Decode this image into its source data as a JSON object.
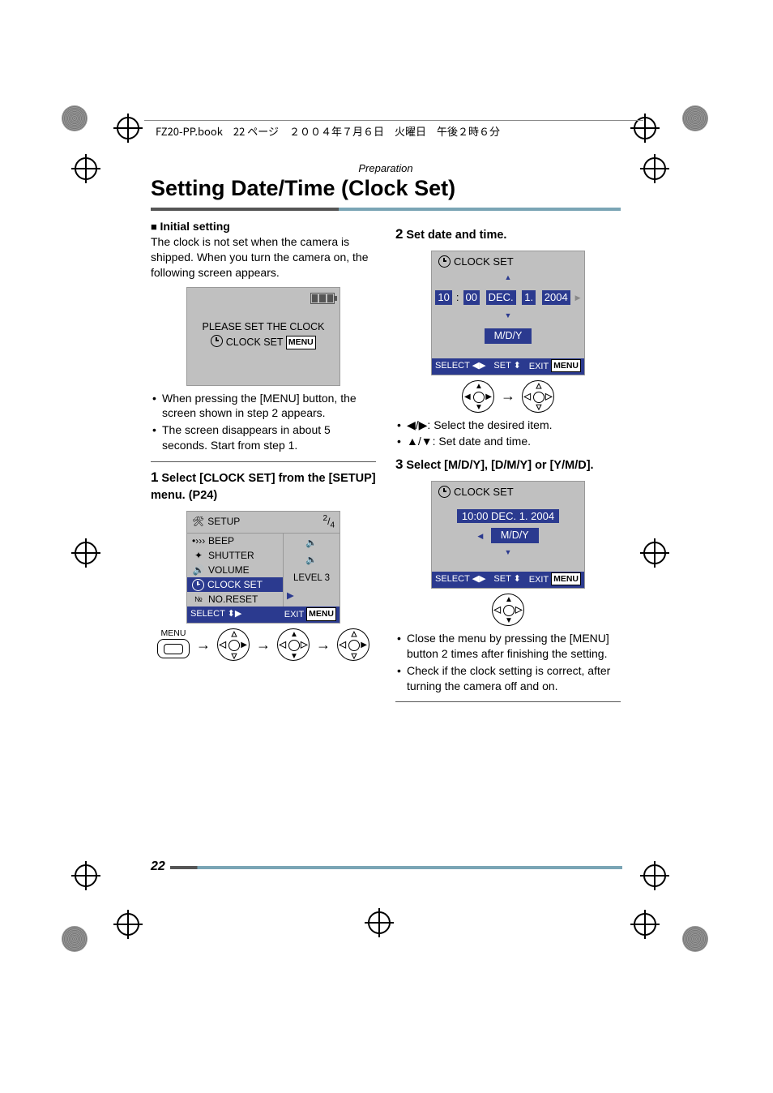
{
  "header_strip": "FZ20-PP.book　22 ページ　２００４年７月６日　火曜日　午後２時６分",
  "preparation": "Preparation",
  "title": "Setting Date/Time (Clock Set)",
  "page_number": "22",
  "left": {
    "initial_heading": "Initial setting",
    "initial_body": "The clock is not set when the camera is shipped. When you turn the camera on, the following screen appears.",
    "screen1_line1": "PLEASE SET THE CLOCK",
    "screen1_line2": "CLOCK SET",
    "screen1_menu": "MENU",
    "bullets_after_screen1": [
      "When pressing the [MENU] button, the screen shown in step 2 appears.",
      "The screen disappears in about 5 seconds. Start from step 1."
    ],
    "step1_num": "1",
    "step1_text": "Select [CLOCK SET] from the [SETUP] menu. (P24)",
    "setup": {
      "header": "SETUP",
      "page_frac": "2/4",
      "items": [
        {
          "label": "BEEP"
        },
        {
          "label": "SHUTTER"
        },
        {
          "label": "VOLUME"
        },
        {
          "label": "CLOCK SET",
          "selected": true
        },
        {
          "label": "NO.RESET"
        }
      ],
      "right_level": "LEVEL 3",
      "foot_select": "SELECT",
      "foot_exit": "EXIT",
      "foot_menu": "MENU"
    },
    "menu_label": "MENU"
  },
  "right": {
    "step2_num": "2",
    "step2_text": "Set date and time.",
    "clock1": {
      "title": "CLOCK SET",
      "hh": "10",
      "colon": ":",
      "mm": "00",
      "mon": "DEC.",
      "day": "1.",
      "year": "2004",
      "fmt": "M/D/Y",
      "foot_select": "SELECT",
      "foot_set": "SET",
      "foot_exit": "EXIT",
      "foot_menu": "MENU"
    },
    "legend": {
      "lr": "◀/▶:  Select the desired item.",
      "ud": "▲/▼:  Set date and time."
    },
    "step3_num": "3",
    "step3_text": "Select [M/D/Y], [D/M/Y] or [Y/M/D].",
    "clock2": {
      "title": "CLOCK SET",
      "datetime": "10:00  DEC.  1. 2004",
      "fmt": "M/D/Y",
      "foot_select": "SELECT",
      "foot_set": "SET",
      "foot_exit": "EXIT",
      "foot_menu": "MENU"
    },
    "bullets_end": [
      "Close the menu by pressing the [MENU] button 2 times after finishing the setting.",
      "Check if the clock setting is correct, after turning the camera off and on."
    ]
  }
}
